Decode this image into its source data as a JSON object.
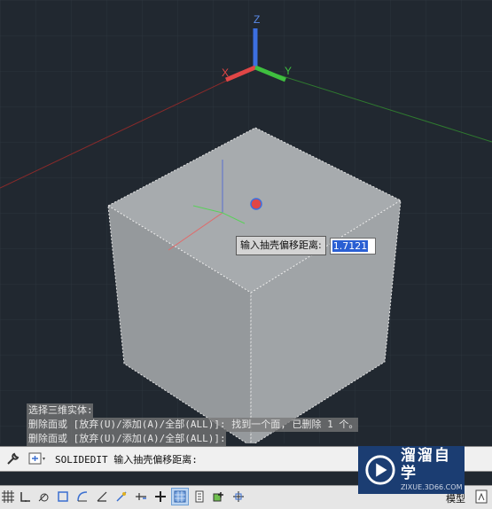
{
  "viewport": {
    "axis_labels": {
      "z": "Z",
      "y": "Y",
      "x": "X"
    }
  },
  "prompt_tooltip": {
    "label": "输入抽壳偏移距离:",
    "value": "1.7121"
  },
  "command_history": [
    "选择三维实体:",
    "删除面或 [放弃(U)/添加(A)/全部(ALL)]: 找到一个面, 已删除 1 个。",
    "删除面或 [放弃(U)/添加(A)/全部(ALL)]:"
  ],
  "command_line": {
    "text": "SOLIDEDIT 输入抽壳偏移距离:"
  },
  "status_bar": {
    "model_tab": "模型",
    "buttons": [
      {
        "name": "grid-icon",
        "on": false
      },
      {
        "name": "snap-icon",
        "on": false
      },
      {
        "name": "infer-icon",
        "on": false
      },
      {
        "name": "ortho-icon",
        "on": false
      },
      {
        "name": "polar-icon",
        "on": false
      },
      {
        "name": "osnap-icon",
        "on": false
      },
      {
        "name": "3d-osnap-icon",
        "on": false
      },
      {
        "name": "otrack-icon",
        "on": false
      },
      {
        "name": "ucs-icon",
        "on": false
      },
      {
        "name": "dyn-input-icon",
        "on": false
      },
      {
        "name": "lineweight-icon",
        "on": true
      },
      {
        "name": "transparency-icon",
        "on": false
      },
      {
        "name": "selection-cycling-icon",
        "on": false
      },
      {
        "name": "annotation-monitor-icon",
        "on": false
      }
    ]
  },
  "watermark": {
    "name": "溜溜自学",
    "url": "ZIXUE.3D66.COM"
  },
  "colors": {
    "background": "#212830",
    "x_axis": "#e04646",
    "y_axis": "#3fbf3f",
    "z_axis": "#3c6fe0",
    "box_top": "#a7abae",
    "box_left": "#95999c",
    "box_right": "#a0a4a7"
  }
}
